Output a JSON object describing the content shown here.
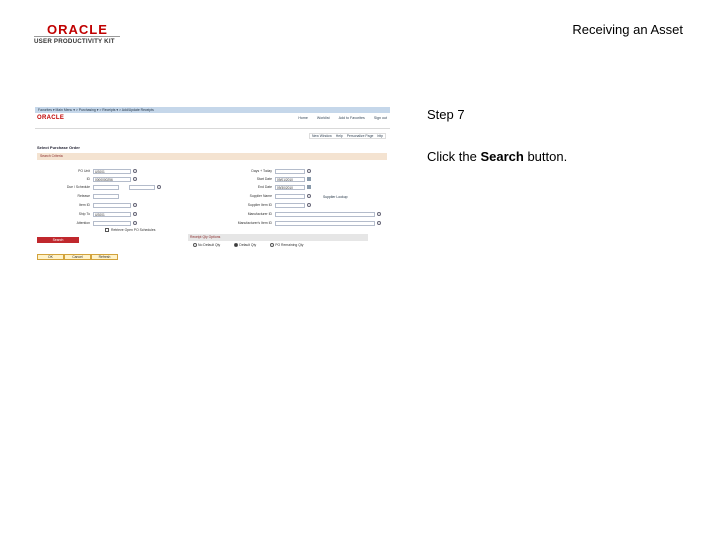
{
  "header": {
    "logo_line1": "ORACLE",
    "logo_line2": "USER PRODUCTIVITY KIT",
    "title": "Receiving an Asset"
  },
  "instructions": {
    "step": "Step 7",
    "text_before": "Click the ",
    "text_bold": "Search",
    "text_after": " button."
  },
  "screenshot": {
    "breadcrumbs": "Favorites ▾   Main Menu ▾   > Purchasing ▾   > Receipts ▾   > Add/Update Receipts",
    "brand": "ORACLE",
    "nav_links": [
      "Home",
      "Worklist",
      "Add to Favorites",
      "Sign out"
    ],
    "tool_links": [
      "New Window",
      "Help",
      "Personalize Page",
      "http"
    ],
    "page_title": "Select Purchase Order",
    "section_title": "Search Criteria",
    "left_fields": [
      {
        "label": "PO Unit",
        "value": "US001",
        "icon": "lookup"
      },
      {
        "label": "ID",
        "value": "0000000256",
        "icon": "lookup"
      },
      {
        "label": "Due / Schedule",
        "value": "",
        "icon": "lookup"
      },
      {
        "label": "Release",
        "value": "",
        "icon": "none"
      },
      {
        "label": "Item ID",
        "value": "",
        "icon": "lookup"
      },
      {
        "label": "Ship To",
        "value": "US001",
        "icon": "lookup"
      },
      {
        "label": "Attention",
        "value": "",
        "icon": "lookup"
      }
    ],
    "right_fields": [
      {
        "label": "Days + Today",
        "value": "",
        "icon": "lookup"
      },
      {
        "label": "Start Date",
        "value": "09/01/2010",
        "icon": "calendar"
      },
      {
        "label": "End Date",
        "value": "09/30/2010",
        "icon": "calendar"
      },
      {
        "label": "Supplier Name",
        "value": "",
        "icon": "lookup"
      },
      {
        "label": "Supplier Item ID",
        "value": "",
        "icon": "lookup"
      },
      {
        "label": "Manufacturer ID",
        "value": "",
        "icon": "lookup"
      },
      {
        "label": "Manufacturer's Item ID",
        "value": "",
        "icon": "lookup"
      }
    ],
    "supplier_link": "Supplier Lookup",
    "retrieve_label": "Retrieve Open PO Schedules",
    "search_label": "Search",
    "options_title": "Receipt Qty Options",
    "radio_options": [
      "No Default Qty",
      "Default Qty",
      "PO Remaining Qty"
    ],
    "radio_selected_index": 1,
    "bottom_buttons": [
      "OK",
      "Cancel",
      "Refresh"
    ]
  },
  "colors": {
    "brand_red": "#c00000",
    "search_button": "#c0282d",
    "top_bar": "#c5d7ea"
  }
}
